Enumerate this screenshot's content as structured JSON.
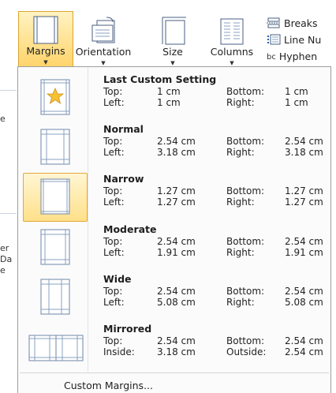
{
  "ribbon": {
    "margins_label": "Margins",
    "orientation_label": "Orientation",
    "size_label": "Size",
    "columns_label": "Columns",
    "breaks_label": "Breaks",
    "line_numbers_label": "Line Nu",
    "hyphenation_label": "Hyphen",
    "hyphen_icon_text": "bc"
  },
  "left_strip": {
    "frag1": "e",
    "frag2": "er",
    "frag3": "Da",
    "frag4": "e"
  },
  "menu": {
    "options": [
      {
        "title": "Last Custom Setting",
        "k1": "Top:",
        "v1": "1 cm",
        "k2": "Bottom:",
        "v2": "1 cm",
        "k3": "Left:",
        "v3": "1 cm",
        "k4": "Right:",
        "v4": "1 cm",
        "icon": "star-icon"
      },
      {
        "title": "Normal",
        "k1": "Top:",
        "v1": "2.54 cm",
        "k2": "Bottom:",
        "v2": "2.54 cm",
        "k3": "Left:",
        "v3": "3.18 cm",
        "k4": "Right:",
        "v4": "3.18 cm"
      },
      {
        "title": "Narrow",
        "k1": "Top:",
        "v1": "1.27 cm",
        "k2": "Bottom:",
        "v2": "1.27 cm",
        "k3": "Left:",
        "v3": "1.27 cm",
        "k4": "Right:",
        "v4": "1.27 cm",
        "selected": true
      },
      {
        "title": "Moderate",
        "k1": "Top:",
        "v1": "2.54 cm",
        "k2": "Bottom:",
        "v2": "2.54 cm",
        "k3": "Left:",
        "v3": "1.91 cm",
        "k4": "Right:",
        "v4": "1.91 cm"
      },
      {
        "title": "Wide",
        "k1": "Top:",
        "v1": "2.54 cm",
        "k2": "Bottom:",
        "v2": "2.54 cm",
        "k3": "Left:",
        "v3": "5.08 cm",
        "k4": "Right:",
        "v4": "5.08 cm"
      },
      {
        "title": "Mirrored",
        "k1": "Top:",
        "v1": "2.54 cm",
        "k2": "Bottom:",
        "v2": "2.54 cm",
        "k3": "Inside:",
        "v3": "3.18 cm",
        "k4": "Outside:",
        "v4": "2.54 cm"
      }
    ],
    "custom_margins_label": "Custom Margins..."
  },
  "colors": {
    "selected_fill": "#ffe08a",
    "selected_border": "#e3a93b",
    "page_line": "#6f86a8"
  }
}
